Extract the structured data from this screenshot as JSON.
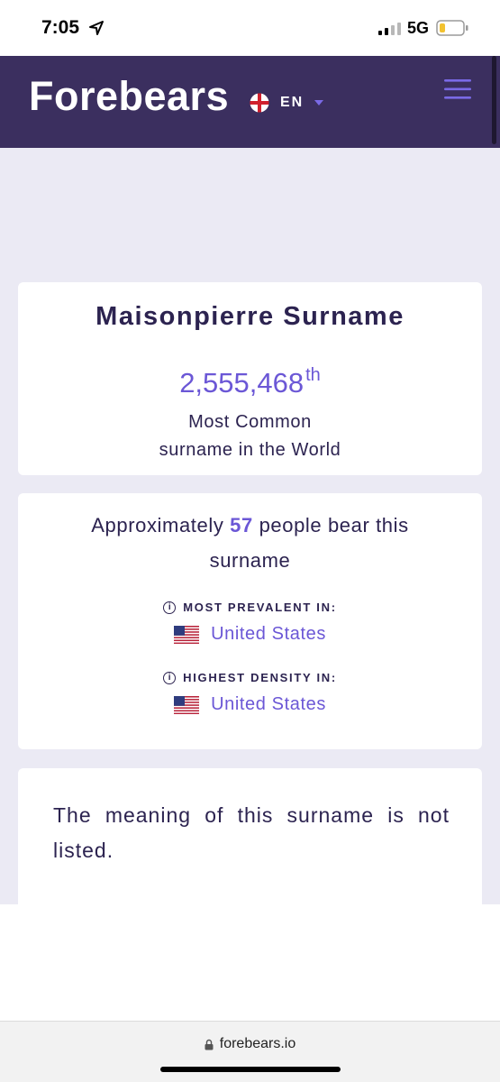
{
  "status_bar": {
    "time": "7:05",
    "network": "5G"
  },
  "header": {
    "logo": "Forebears",
    "language": "EN"
  },
  "summary_card": {
    "title": "Maisonpierre Surname",
    "rank": "2,555,468",
    "rank_suffix": "th",
    "caption_line1": "Most Common",
    "caption_line2": "surname in the World"
  },
  "stats_card": {
    "approx_prefix": "Approximately",
    "count": "57",
    "approx_suffix": "people bear this surname",
    "prevalent_label": "MOST PREVALENT IN:",
    "prevalent_country": "United States",
    "density_label": "HIGHEST DENSITY IN:",
    "density_country": "United States"
  },
  "meaning_card": {
    "text": "The meaning of this surname is not listed."
  },
  "browser": {
    "url": "forebears.io"
  },
  "colors": {
    "header_bg": "#3b2f5f",
    "accent": "#6b57d6",
    "page_bg": "#ebeaf4",
    "text": "#2c2350"
  }
}
